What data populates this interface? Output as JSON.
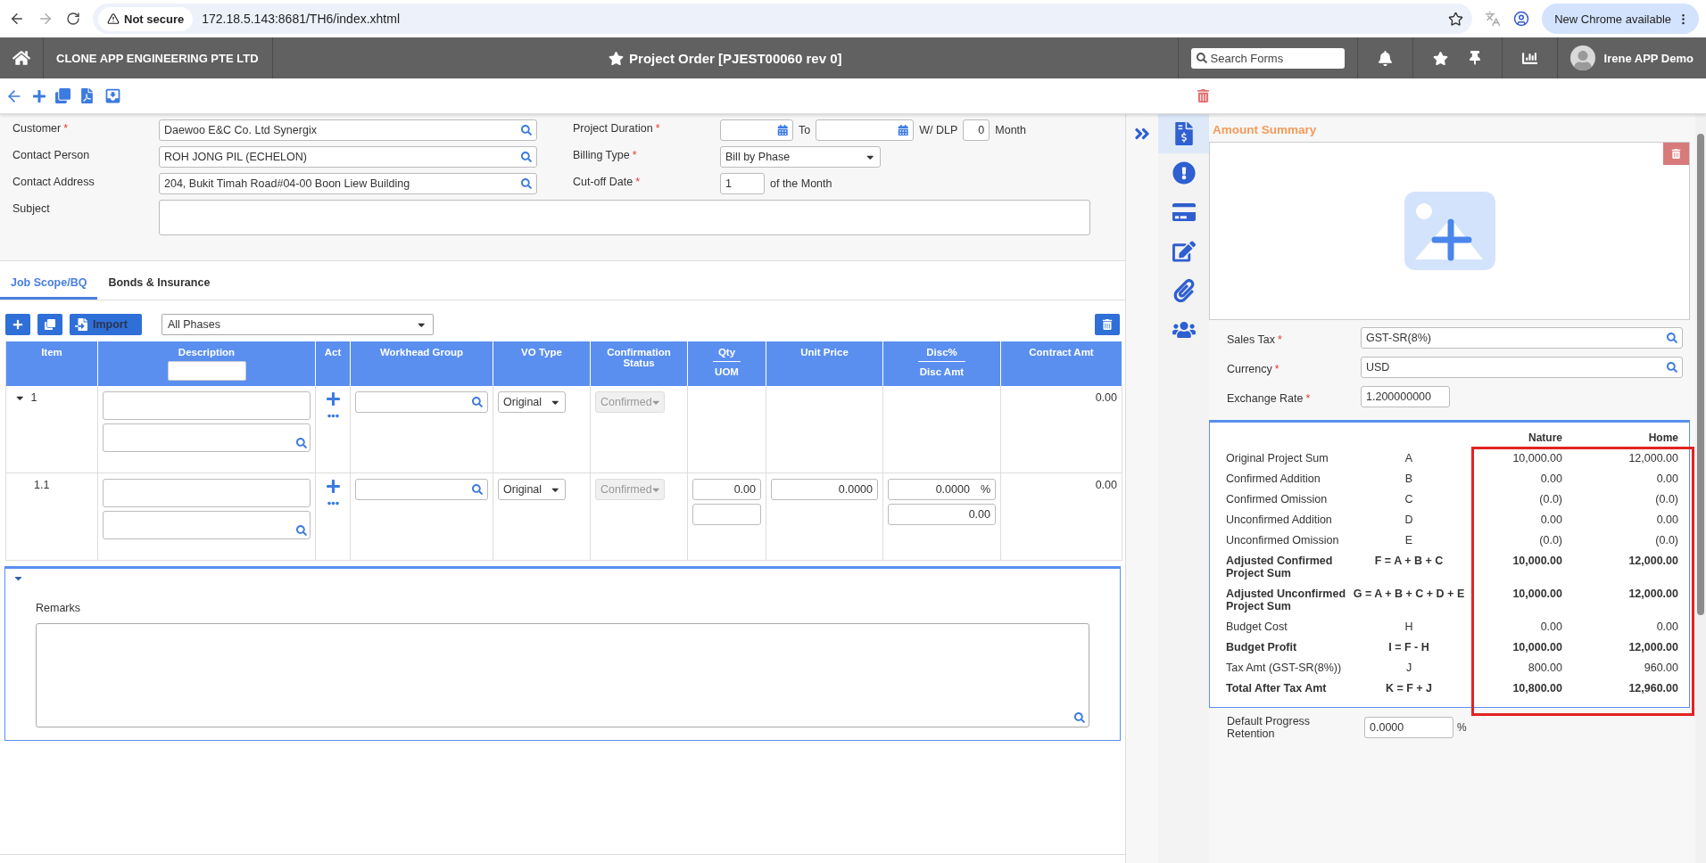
{
  "required_mark": "*",
  "browser": {
    "security": "Not secure",
    "url": "172.18.5.143:8681/TH6/index.xhtml",
    "update_button": "New Chrome available"
  },
  "header": {
    "company": "CLONE APP ENGINEERING PTE LTD",
    "title": "Project Order [PJEST00060 rev 0]",
    "search_placeholder": "Search Forms",
    "user": "Irene APP Demo"
  },
  "form": {
    "left_fields": [
      {
        "label": "Customer",
        "required": true,
        "value": "Daewoo E&C Co. Ltd Synergix"
      },
      {
        "label": "Contact Person",
        "required": false,
        "value": "ROH JONG PIL (ECHELON)"
      },
      {
        "label": "Contact Address",
        "required": false,
        "value": "204, Bukit Timah Road#04-00 Boon Liew Building"
      }
    ],
    "subject_label": "Subject",
    "project_duration": {
      "label": "Project Duration",
      "required": true,
      "to_label": "To",
      "dlp_label": "W/ DLP",
      "dlp_value": "0",
      "month_label": "Month"
    },
    "billing_type": {
      "label": "Billing Type",
      "required": true,
      "value": "Bill by Phase"
    },
    "cutoff_date": {
      "label": "Cut-off Date",
      "required": true,
      "value": "1",
      "suffix": "of the Month"
    }
  },
  "tabs": [
    {
      "label": "Job Scope/BQ",
      "selected": true
    },
    {
      "label": "Bonds & Insurance",
      "selected": false
    }
  ],
  "grid_toolbar": {
    "import_label": "Import",
    "phase_filter": "All Phases"
  },
  "table": {
    "columns": [
      {
        "label": "Item"
      },
      {
        "label": "Description",
        "filter": true
      },
      {
        "label": "Act"
      },
      {
        "label": "Workhead Group"
      },
      {
        "label": "VO Type"
      },
      {
        "label": "Confirmation Status"
      },
      {
        "label": "Qty",
        "sublabel": "UOM"
      },
      {
        "label": "Unit Price"
      },
      {
        "label": "Disc%",
        "sublabel": "Disc Amt"
      },
      {
        "label": "Contract Amt"
      }
    ],
    "rows": [
      {
        "kind": "group",
        "item": "1",
        "expanded": true,
        "vo_type": "Original",
        "confirmation": "Confirmed",
        "contract_amt": "0.00"
      },
      {
        "kind": "line",
        "item": "1.1",
        "vo_type": "Original",
        "confirmation": "Confirmed",
        "qty": "0.00",
        "unit_price": "0.0000",
        "disc_pct": "0.0000",
        "pct_sign": "%",
        "disc_amt": "0.00",
        "contract_amt": "0.00"
      }
    ]
  },
  "remarks": {
    "label": "Remarks",
    "expanded": true
  },
  "side_tabs": [
    {
      "kind": "amount",
      "selected": true
    },
    {
      "kind": "alert",
      "selected": false
    },
    {
      "kind": "card",
      "selected": false
    },
    {
      "kind": "edit",
      "selected": false
    },
    {
      "kind": "attachment",
      "selected": false
    },
    {
      "kind": "team",
      "selected": false
    }
  ],
  "summary": {
    "title": "Amount Summary",
    "fields": [
      {
        "label": "Sales Tax",
        "required": true,
        "value": "GST-SR(8%)",
        "kind": "lookup"
      },
      {
        "label": "Currency",
        "required": true,
        "value": "USD",
        "kind": "lookup"
      },
      {
        "label": "Exchange Rate",
        "required": true,
        "value": "1.200000000",
        "kind": "short"
      }
    ],
    "columns": [
      "Nature",
      "Home"
    ],
    "rows": [
      {
        "label": "Original Project Sum",
        "code": "A",
        "nature": "10,000.00",
        "home": "12,000.00",
        "bold": false
      },
      {
        "label": "Confirmed Addition",
        "code": "B",
        "nature": "0.00",
        "home": "0.00",
        "bold": false
      },
      {
        "label": "Confirmed Omission",
        "code": "C",
        "nature": "(0.0)",
        "home": "(0.0)",
        "bold": false
      },
      {
        "label": "Unconfirmed Addition",
        "code": "D",
        "nature": "0.00",
        "home": "0.00",
        "bold": false
      },
      {
        "label": "Unconfirmed Omission",
        "code": "E",
        "nature": "(0.0)",
        "home": "(0.0)",
        "bold": false
      },
      {
        "label": "Adjusted Confirmed Project Sum",
        "code": "F = A + B + C",
        "nature": "10,000.00",
        "home": "12,000.00",
        "bold": true
      },
      {
        "label": "Adjusted Unconfirmed Project Sum",
        "code": "G = A + B + C + D + E",
        "nature": "10,000.00",
        "home": "12,000.00",
        "bold": true
      },
      {
        "label": "Budget Cost",
        "code": "H",
        "nature": "0.00",
        "home": "0.00",
        "bold": false
      },
      {
        "label": "Budget Profit",
        "code": "I = F - H",
        "nature": "10,000.00",
        "home": "12,000.00",
        "bold": true
      },
      {
        "label": "Tax Amt (GST-SR(8%))",
        "code": "J",
        "nature": "800.00",
        "home": "960.00",
        "bold": false
      },
      {
        "label": "Total After Tax Amt",
        "code": "K = F + J",
        "nature": "10,800.00",
        "home": "12,960.00",
        "bold": true
      }
    ],
    "highlighted": true,
    "retention": {
      "label": "Default Progress Retention",
      "value": "0.0000",
      "suffix": "%"
    }
  }
}
